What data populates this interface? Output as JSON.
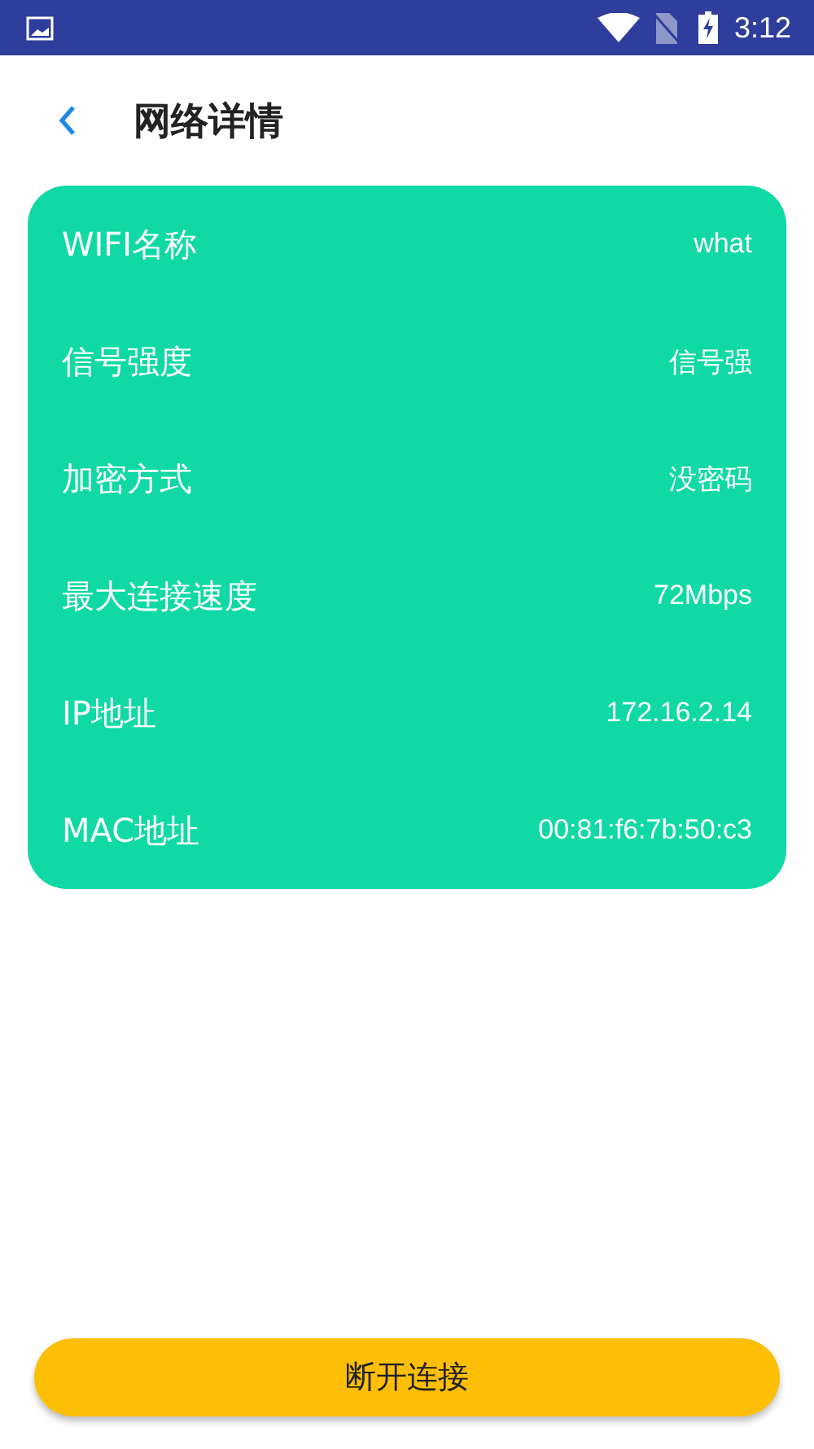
{
  "status_bar": {
    "time": "3:12"
  },
  "header": {
    "title": "网络详情"
  },
  "details": [
    {
      "label": "WIFI名称",
      "value": "what"
    },
    {
      "label": "信号强度",
      "value": "信号强"
    },
    {
      "label": "加密方式",
      "value": "没密码"
    },
    {
      "label": "最大连接速度",
      "value": "72Mbps"
    },
    {
      "label": "IP地址",
      "value": "172.16.2.14"
    },
    {
      "label": "MAC地址",
      "value": "00:81:f6:7b:50:c3"
    }
  ],
  "action_button": {
    "label": "断开连接"
  }
}
